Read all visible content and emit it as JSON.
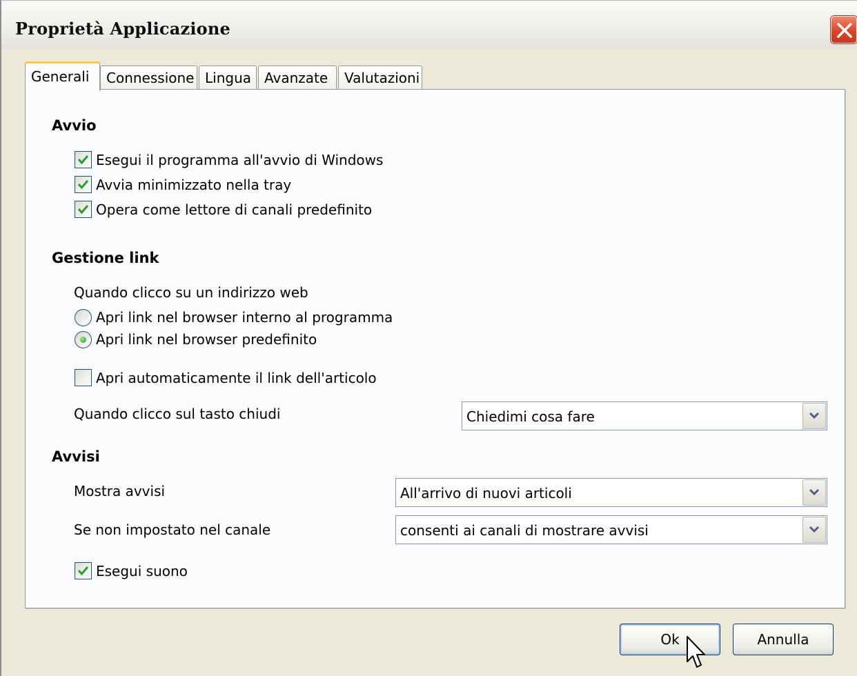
{
  "window": {
    "title": "Proprietà Applicazione",
    "close_icon": "close-icon"
  },
  "tabs": [
    {
      "label": "Generali",
      "active": true
    },
    {
      "label": "Connessione",
      "active": false
    },
    {
      "label": "Lingua",
      "active": false
    },
    {
      "label": "Avanzate",
      "active": false
    },
    {
      "label": "Valutazioni",
      "active": false
    }
  ],
  "avvio": {
    "heading": "Avvio",
    "options": [
      {
        "label": "Esegui il programma all'avvio di Windows",
        "checked": true
      },
      {
        "label": "Avvia minimizzato nella tray",
        "checked": true
      },
      {
        "label": "Opera come lettore di canali predefinito",
        "checked": true
      }
    ]
  },
  "gestione_link": {
    "heading": "Gestione link",
    "prompt": "Quando clicco su un indirizzo web",
    "radios": [
      {
        "label": "Apri link nel browser interno al programma",
        "selected": false
      },
      {
        "label": "Apri link nel browser predefinito",
        "selected": true
      }
    ],
    "auto_open": {
      "label": "Apri automaticamente il link dell'articolo",
      "checked": false
    },
    "close_label": "Quando clicco sul tasto chiudi",
    "close_value": "Chiedimi cosa fare"
  },
  "avvisi": {
    "heading": "Avvisi",
    "show_label": "Mostra avvisi",
    "show_value": "All'arrivo di nuovi articoli",
    "channel_label": "Se non impostato nel canale",
    "channel_value": "consenti ai canali di mostrare avvisi",
    "sound": {
      "label": "Esegui suono",
      "checked": true
    }
  },
  "buttons": {
    "ok": "Ok",
    "cancel": "Annulla"
  },
  "colors": {
    "check": "#21a121",
    "tab_accent": "#ffc83c",
    "close": "#d9472a"
  }
}
